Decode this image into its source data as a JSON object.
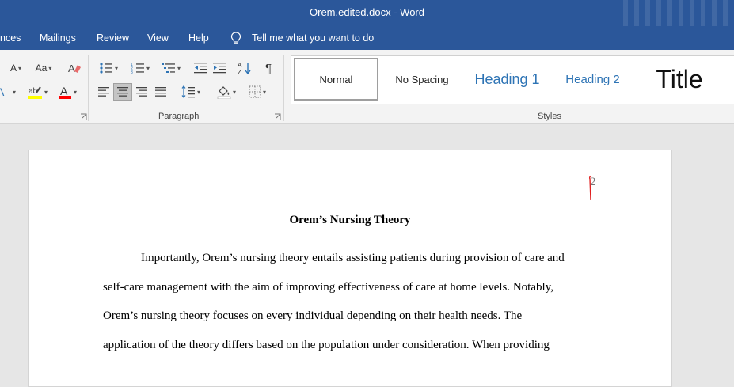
{
  "window": {
    "title": "Orem.edited.docx  -  Word"
  },
  "menu": {
    "items": [
      "nces",
      "Mailings",
      "Review",
      "View",
      "Help"
    ],
    "tell_me": "Tell me what you want to do"
  },
  "ribbon": {
    "font_group": {
      "font_size_label": "A",
      "change_case_label": "Aa"
    },
    "paragraph_group": {
      "label": "Paragraph"
    },
    "styles_group": {
      "label": "Styles",
      "items": [
        "Normal",
        "No Spacing",
        "Heading 1",
        "Heading 2",
        "Title"
      ],
      "selected": "Normal"
    },
    "colors": {
      "highlight": "#ffff00",
      "font_color": "#ff0000",
      "heading_blue": "#2e74b5"
    }
  },
  "document": {
    "page_number": "2",
    "title": "Orem’s Nursing Theory",
    "lines": [
      "Importantly, Orem’s nursing theory entails assisting patients during provision of care and",
      "self-care management with the aim of improving effectiveness of care at home levels. Notably,",
      "Orem’s nursing theory focuses on every individual depending on their health needs. The",
      "application of the theory differs based on the population under consideration. When providing"
    ]
  }
}
